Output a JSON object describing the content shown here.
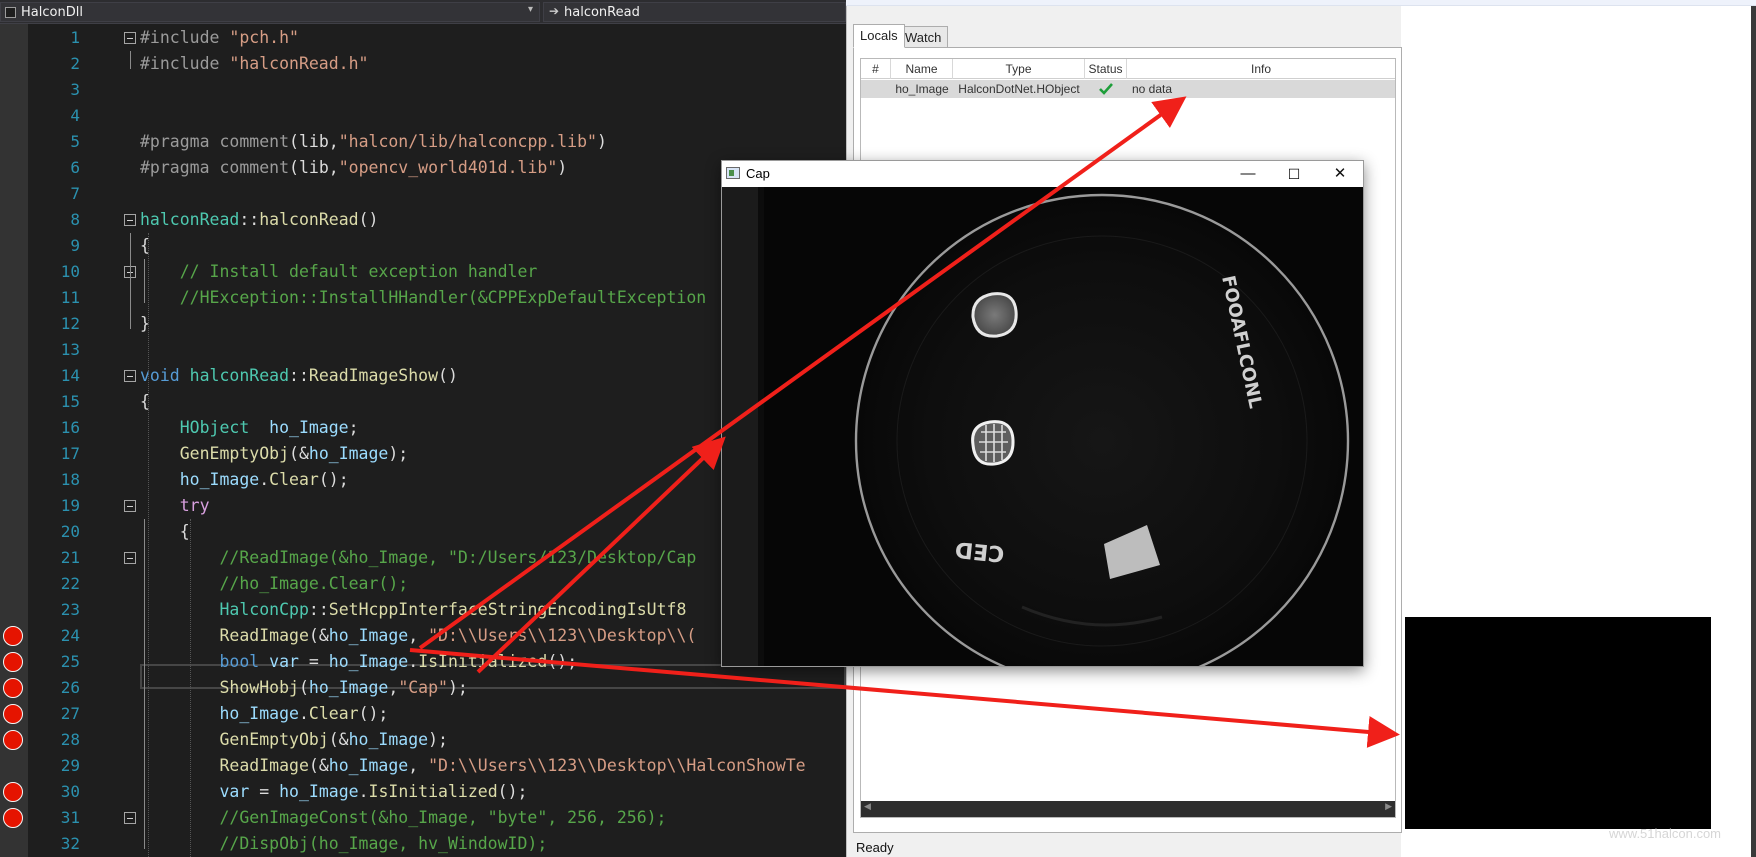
{
  "editor": {
    "nav_left_label": "HalconDll",
    "nav_right_label": "halconRead",
    "line_numbers": [
      "1",
      "2",
      "3",
      "4",
      "5",
      "6",
      "7",
      "8",
      "9",
      "10",
      "11",
      "12",
      "13",
      "14",
      "15",
      "16",
      "17",
      "18",
      "19",
      "20",
      "21",
      "22",
      "23",
      "24",
      "25",
      "26",
      "27",
      "28",
      "29",
      "30",
      "31",
      "32"
    ],
    "lines": [
      [
        {
          "c": "pp",
          "t": "#include "
        },
        {
          "c": "st",
          "t": "\"pch.h\""
        }
      ],
      [
        {
          "c": "pp",
          "t": "#include "
        },
        {
          "c": "st",
          "t": "\"halconRead.h\""
        }
      ],
      [],
      [],
      [
        {
          "c": "pp",
          "t": "#pragma "
        },
        {
          "c": "pp",
          "t": "comment"
        },
        {
          "c": "pl",
          "t": "(lib,"
        },
        {
          "c": "st",
          "t": "\"halcon/lib/halconcpp.lib\""
        },
        {
          "c": "pl",
          "t": ")"
        }
      ],
      [
        {
          "c": "pp",
          "t": "#pragma "
        },
        {
          "c": "pp",
          "t": "comment"
        },
        {
          "c": "pl",
          "t": "(lib,"
        },
        {
          "c": "st",
          "t": "\"opencv_world401d.lib\""
        },
        {
          "c": "pl",
          "t": ")"
        }
      ],
      [],
      [
        {
          "c": "ty",
          "t": "halconRead"
        },
        {
          "c": "pl",
          "t": "::"
        },
        {
          "c": "fn",
          "t": "halconRead"
        },
        {
          "c": "pl",
          "t": "()"
        }
      ],
      [
        {
          "c": "pl",
          "t": "{"
        }
      ],
      [
        {
          "c": "cm",
          "t": "    // Install default exception handler"
        }
      ],
      [
        {
          "c": "cm",
          "t": "    //HException::InstallHHandler(&CPPExpDefaultException"
        }
      ],
      [
        {
          "c": "pl",
          "t": "}"
        }
      ],
      [],
      [
        {
          "c": "kw",
          "t": "void "
        },
        {
          "c": "ty",
          "t": "halconRead"
        },
        {
          "c": "pl",
          "t": "::"
        },
        {
          "c": "fn",
          "t": "ReadImageShow"
        },
        {
          "c": "pl",
          "t": "()"
        }
      ],
      [
        {
          "c": "pl",
          "t": "{"
        }
      ],
      [
        {
          "c": "ty",
          "t": "    HObject  "
        },
        {
          "c": "vr",
          "t": "ho_Image"
        },
        {
          "c": "pl",
          "t": ";"
        }
      ],
      [
        {
          "c": "fn",
          "t": "    GenEmptyObj"
        },
        {
          "c": "pl",
          "t": "(&"
        },
        {
          "c": "vr",
          "t": "ho_Image"
        },
        {
          "c": "pl",
          "t": ");"
        }
      ],
      [
        {
          "c": "vr",
          "t": "    ho_Image"
        },
        {
          "c": "pl",
          "t": "."
        },
        {
          "c": "fn",
          "t": "Clear"
        },
        {
          "c": "pl",
          "t": "();"
        }
      ],
      [
        {
          "c": "ct",
          "t": "    try"
        }
      ],
      [
        {
          "c": "pl",
          "t": "    {"
        }
      ],
      [
        {
          "c": "cm",
          "t": "        //ReadImage(&ho_Image, \"D:/Users/123/Desktop/Cap"
        }
      ],
      [
        {
          "c": "cm",
          "t": "        //ho_Image.Clear();"
        }
      ],
      [
        {
          "c": "ty",
          "t": "        HalconCpp"
        },
        {
          "c": "pl",
          "t": "::"
        },
        {
          "c": "fn",
          "t": "SetHcppInterfaceStringEncodingIsUtf8"
        }
      ],
      [
        {
          "c": "fn",
          "t": "        ReadImage"
        },
        {
          "c": "pl",
          "t": "(&"
        },
        {
          "c": "vr",
          "t": "ho_Image"
        },
        {
          "c": "pl",
          "t": ", "
        },
        {
          "c": "st",
          "t": "\"D:\\\\Users\\\\123\\\\Desktop\\\\("
        }
      ],
      [
        {
          "c": "kw",
          "t": "        bool "
        },
        {
          "c": "vr",
          "t": "var"
        },
        {
          "c": "pl",
          "t": " = "
        },
        {
          "c": "vr",
          "t": "ho_Image"
        },
        {
          "c": "pl",
          "t": "."
        },
        {
          "c": "fn",
          "t": "IsInitialized"
        },
        {
          "c": "pl",
          "t": "();"
        }
      ],
      [
        {
          "c": "fn",
          "t": "        ShowHobj"
        },
        {
          "c": "pl",
          "t": "("
        },
        {
          "c": "vr",
          "t": "ho_Image"
        },
        {
          "c": "pl",
          "t": ","
        },
        {
          "c": "st",
          "t": "\"Cap\""
        },
        {
          "c": "pl",
          "t": ");"
        }
      ],
      [
        {
          "c": "vr",
          "t": "        ho_Image"
        },
        {
          "c": "pl",
          "t": "."
        },
        {
          "c": "fn",
          "t": "Clear"
        },
        {
          "c": "pl",
          "t": "();"
        }
      ],
      [
        {
          "c": "fn",
          "t": "        GenEmptyObj"
        },
        {
          "c": "pl",
          "t": "(&"
        },
        {
          "c": "vr",
          "t": "ho_Image"
        },
        {
          "c": "pl",
          "t": ");"
        }
      ],
      [
        {
          "c": "fn",
          "t": "        ReadImage"
        },
        {
          "c": "pl",
          "t": "(&"
        },
        {
          "c": "vr",
          "t": "ho_Image"
        },
        {
          "c": "pl",
          "t": ", "
        },
        {
          "c": "st",
          "t": "\"D:\\\\Users\\\\123\\\\Desktop\\\\HalconShowTe"
        }
      ],
      [
        {
          "c": "vr",
          "t": "        var"
        },
        {
          "c": "pl",
          "t": " = "
        },
        {
          "c": "vr",
          "t": "ho_Image"
        },
        {
          "c": "pl",
          "t": "."
        },
        {
          "c": "fn",
          "t": "IsInitialized"
        },
        {
          "c": "pl",
          "t": "();"
        }
      ],
      [
        {
          "c": "cm",
          "t": "        //GenImageConst(&ho_Image, \"byte\", 256, 256);"
        }
      ],
      [
        {
          "c": "cm",
          "t": "        //DispObj(ho_Image, hv_WindowID);"
        }
      ]
    ]
  },
  "debugger": {
    "tabs": [
      "Locals",
      "Watch"
    ],
    "columns": [
      "#",
      "Name",
      "Type",
      "Status",
      "Info"
    ],
    "rows": [
      {
        "num": "",
        "name": "ho_Image",
        "type": "HalconDotNet.HObject",
        "status_icon": "check-icon",
        "info": "no data"
      }
    ],
    "status_text": "Ready",
    "watermark": "www.51halcon.com"
  },
  "cap_window": {
    "title": "Cap",
    "minimize": "—",
    "maximize": "☐",
    "close": "✕",
    "image_text_bottom": "CED",
    "image_text_right": "FOOAFLCONL"
  },
  "colors": {
    "editor_bg": "#1e1e1e",
    "breakpoint": "#e51400",
    "annotation_arrow": "#f0201a",
    "status_ok": "#1e9e3a"
  }
}
